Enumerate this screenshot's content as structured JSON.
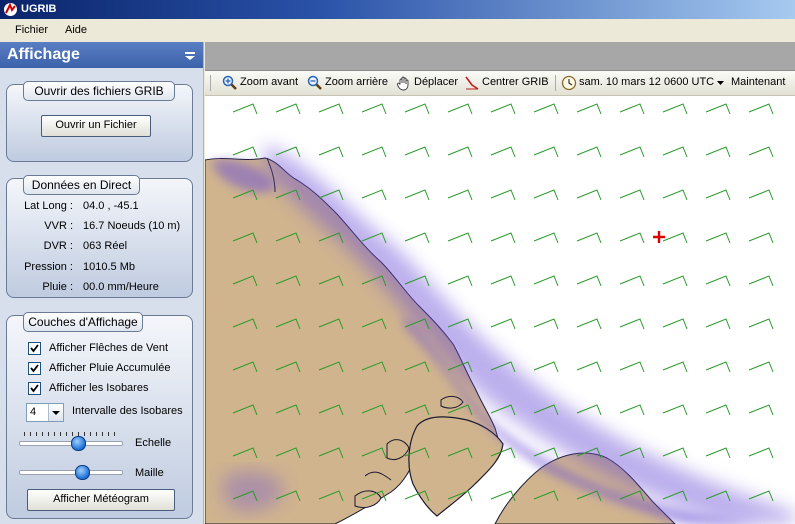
{
  "app": {
    "title": "UGRIB"
  },
  "menu": {
    "items": [
      {
        "label": "Fichier"
      },
      {
        "label": "Aide"
      }
    ]
  },
  "panel": {
    "title": "Affichage",
    "open_group": {
      "title": "Ouvrir des fichiers GRIB",
      "button": "Ouvrir un Fichier"
    },
    "direct_group": {
      "title": "Données en Direct",
      "rows": [
        {
          "label": "Lat Long :",
          "value": "04.0 ,  -45.1"
        },
        {
          "label": "VVR :",
          "value": "16.7 Noeuds (10 m)"
        },
        {
          "label": "DVR :",
          "value": "063 Réel"
        },
        {
          "label": "Pression :",
          "value": "1010.5 Mb"
        },
        {
          "label": "Pluie :",
          "value": "00.0 mm/Heure"
        }
      ]
    },
    "layers_group": {
      "title": "Couches d'Affichage",
      "checks": [
        {
          "label": "Afficher Flêches de Vent",
          "checked": true
        },
        {
          "label": "Afficher Pluie Accumulée",
          "checked": true
        },
        {
          "label": "Afficher les Isobares",
          "checked": true
        }
      ],
      "isobar_interval": {
        "value": "4",
        "label": "Intervalle des Isobares"
      },
      "echelle": {
        "label": "Echelle",
        "level": 0.58
      },
      "maille": {
        "label": "Maille",
        "level": 0.63
      },
      "meteogram_button": "Afficher Météogram"
    }
  },
  "toolbar": {
    "zoom_in": "Zoom avant",
    "zoom_out": "Zoom arrière",
    "pan": "Déplacer",
    "center": "Centrer GRIB",
    "datetime": "sam. 10 mars 12 0600 UTC",
    "now": "Maintenant"
  },
  "map": {
    "colors": {
      "land": "#d0b48e",
      "coast": "#1a1a2e",
      "wind": "#2a9a2a",
      "rain": "#6b4fd6",
      "marker": "#e00000"
    },
    "wind_direction_deg": 63
  }
}
